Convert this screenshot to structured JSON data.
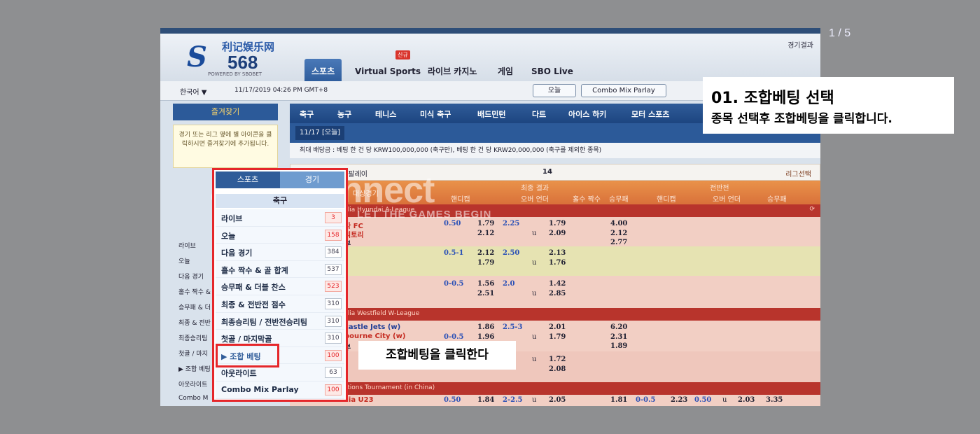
{
  "counter": "1 / 5",
  "logo": {
    "brand_cn": "利记娱乐网",
    "number": "568",
    "sub": "POWERED BY SBOBET"
  },
  "header": {
    "result_link": "경기결과",
    "tabs": [
      "스포츠",
      "Virtual Sports",
      "라이브 카지노",
      "게임",
      "SBO Live"
    ],
    "new_badge": "신규"
  },
  "toolbar": {
    "language": "한국어 ▼",
    "datetime": "11/17/2019 04:26 PM GMT+8",
    "today_btn": "오늘",
    "combo_btn": "Combo Mix Parlay",
    "combo_badge": "new"
  },
  "sidebar": {
    "favorites_title": "즐겨찾기",
    "favorites_hint": "경기 또는 리그 옆에 별 아이콘을 클릭하시면 즐겨찾기에 추가됩니다.",
    "items": [
      "라이브",
      "오늘",
      "다음 경기",
      "홀수 짝수 &",
      "승무패 & 더",
      "최종 & 전반",
      "최종승리팀",
      "첫골 / 마지",
      "▶ 조합 베팅",
      "아웃라이트",
      "Combo M"
    ]
  },
  "sport_tabs": [
    "축구",
    "농구",
    "테니스",
    "미식 축구",
    "배드민턴",
    "다트",
    "아이스 하키",
    "모터 스포츠"
  ],
  "date_tab": "11/17 [오늘]",
  "limit_text": "최대 배당금 : 베팅 한 건 당 KRW100,000,000 (축구만), 베팅 한 건 당 KRW20,000,000 (축구를 제외한 종목)",
  "table": {
    "title": "스 팔레이",
    "count": "14",
    "league_select": "리그선택",
    "header_group1": "최종 결과",
    "header_group2": "전반전",
    "header_cols": [
      "대상경기",
      "핸디캡",
      "오버 언더",
      "홀수 짝수",
      "승무패",
      "핸디캡",
      "오버 언더",
      "승무패"
    ],
    "leagues": [
      "tralia Hyundai A-League",
      "tralia Westfield W-League",
      "Nations Tournament (in China)"
    ],
    "rows": [
      {
        "teams": [
          "다 FC",
          "빅토리",
          "부"
        ],
        "hdp": "0.50",
        "hdp_odds": [
          "1.79",
          "2.12"
        ],
        "ou": "2.25",
        "ou_odds": [
          "1.79",
          "2.09"
        ],
        "x12": [
          "4.00",
          "2.12",
          "2.77"
        ]
      },
      {
        "teams": [],
        "hdp": "0.5-1",
        "hdp_odds": [
          "2.12",
          "1.79"
        ],
        "ou": "2.50",
        "ou_odds": [
          "2.13",
          "1.76"
        ]
      },
      {
        "teams": [],
        "hdp": "0-0.5",
        "hdp_odds": [
          "1.56",
          "2.51"
        ],
        "ou": "2.0",
        "ou_odds": [
          "1.42",
          "2.85"
        ]
      },
      {
        "teams": [
          "castle Jets (w)",
          "bourne City (w)",
          "부"
        ],
        "hdp": "0-0.5",
        "hdp_odds": [
          "1.86",
          "1.96"
        ],
        "ou": "2.5-3",
        "ou_odds": [
          "2.01",
          "1.79"
        ],
        "x12": [
          "6.20",
          "2.31",
          "1.89"
        ]
      },
      {
        "teams": [],
        "ou_odds": [
          "1.72",
          "2.08"
        ]
      },
      {
        "teams": [
          "tralia U23"
        ],
        "hdp": "0.50",
        "hdp_odds": [
          "1.84"
        ],
        "ou": "2-2.5",
        "ou_odds": [
          "2.05"
        ],
        "x12": [
          "1.81"
        ],
        "fh_hdp": "0-0.5",
        "fh_hdp_odds": "2.23",
        "fh_ou": "0.50",
        "fh_ou_odds": "2.03",
        "fh_x12": "3.35"
      }
    ],
    "ou_marker": "u"
  },
  "watermark": {
    "brand": "asianconnect",
    "tagline": "LET THE GAMES BEGIN"
  },
  "popup": {
    "tab_sports": "스포츠",
    "tab_match": "경기",
    "sport": "축구",
    "items": [
      {
        "label": "라이브",
        "count": "3",
        "red": true
      },
      {
        "label": "오늘",
        "count": "158",
        "red": true
      },
      {
        "label": "다음 경기",
        "count": "384",
        "red": false
      },
      {
        "label": "홀수 짝수 & 골 합계",
        "count": "537",
        "red": false
      },
      {
        "label": "승무패 & 더블 찬스",
        "count": "523",
        "red": true
      },
      {
        "label": "최종 & 전반전 점수",
        "count": "310",
        "red": false
      },
      {
        "label": "최종승리팀 / 전반전승리팀",
        "count": "310",
        "red": false
      },
      {
        "label": "첫골 / 마지막골",
        "count": "310",
        "red": false
      },
      {
        "label": "▶ 조합 베팅",
        "count": "100",
        "red": true
      },
      {
        "label": "아웃라이트",
        "count": "63",
        "red": false
      },
      {
        "label": "Combo Mix Parlay",
        "count": "100",
        "red": true
      }
    ]
  },
  "step": {
    "title": "01. 조합베팅 선택",
    "desc": "종목 선택후 조합베팅을 클릭합니다."
  },
  "callout": "조합베팅을 클릭한다",
  "colors": {
    "highlight": "#e5262a",
    "nav_blue": "#2c5a99",
    "table_orange": "#d9713a"
  }
}
